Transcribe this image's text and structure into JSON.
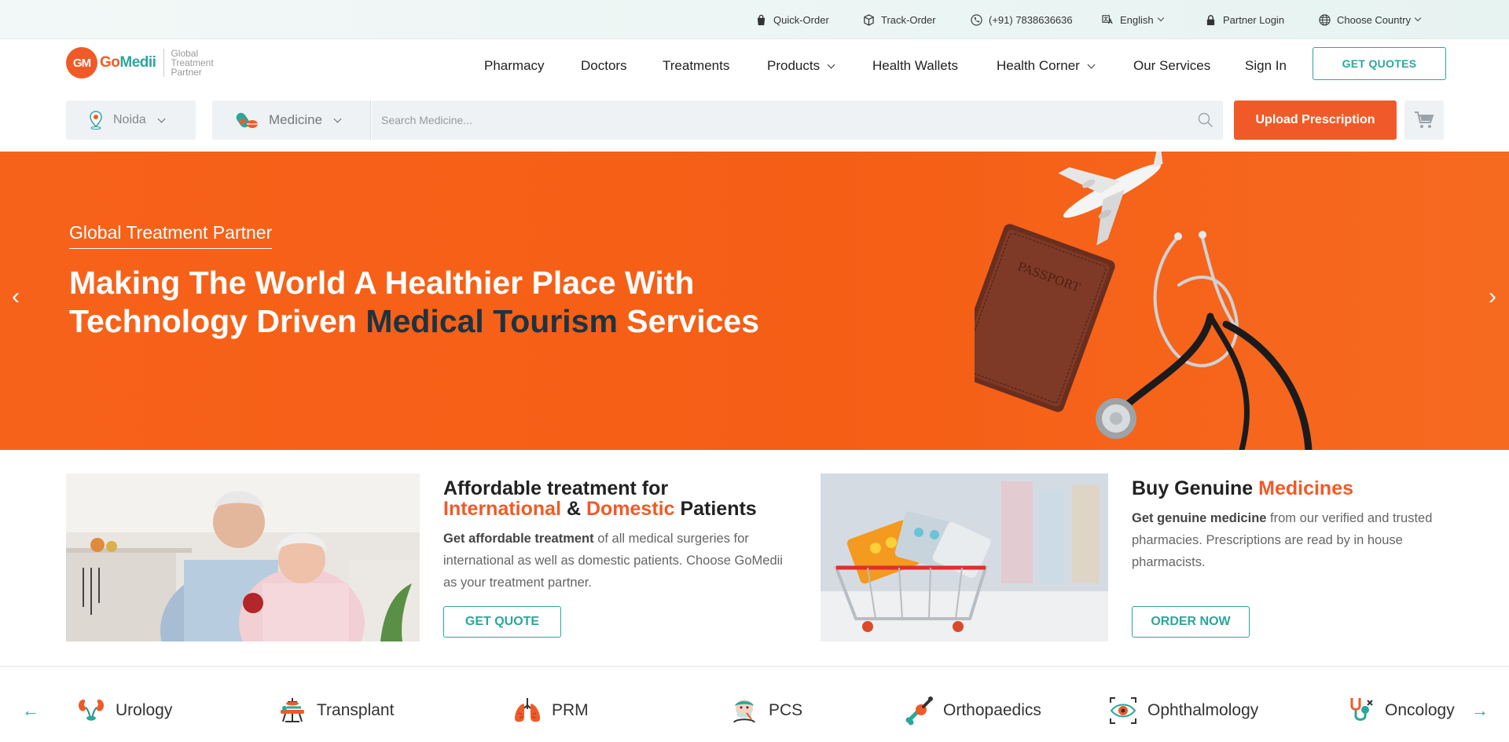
{
  "topbar": {
    "quick_order": "Quick-Order",
    "track_order": "Track-Order",
    "phone": "(+91) 7838636636",
    "language": "English",
    "partner_login": "Partner Login",
    "country": "Choose Country"
  },
  "brand": {
    "mark": "GM",
    "name_a": "Go",
    "name_b": "Medii",
    "tagline": "Global Treatment Partner"
  },
  "nav": {
    "items": [
      "Pharmacy",
      "Doctors",
      "Treatments",
      "Products",
      "Health Wallets",
      "Health Corner",
      "Our Services",
      "Sign In"
    ],
    "get_quotes": "GET QUOTES"
  },
  "search": {
    "location": "Noida",
    "category": "Medicine",
    "placeholder": "Search Medicine...",
    "upload_label": "Upload Prescription"
  },
  "hero": {
    "eyebrow": "Global Treatment Partner",
    "title_part1": "Making The World A Healthier Place With Technology Driven ",
    "title_accent": "Medical Tourism",
    "title_part2": " Services",
    "art_label": "PASSPORT",
    "prev": "‹",
    "next": "›"
  },
  "cards": {
    "treatment": {
      "title_l1": "Affordable treatment for",
      "title_o1": "International",
      "title_amp": " & ",
      "title_o2": "Domestic",
      "title_end": " Patients",
      "body_bold": "Get affordable treatment",
      "body_rest": " of all medical surgeries for international as well as domestic patients. Choose GoMedii as your treatment partner.",
      "button": "GET QUOTE"
    },
    "medicine": {
      "title_a": "Buy Genuine ",
      "title_o": "Medicines",
      "body_bold": "Get genuine medicine",
      "body_rest": " from our verified and trusted pharmacies. Prescriptions are read by in house pharmacists.",
      "button": "ORDER NOW"
    }
  },
  "specialties": {
    "items": [
      "Urology",
      "Transplant",
      "PRM",
      "PCS",
      "Orthopaedics",
      "Ophthalmology",
      "Oncology"
    ],
    "prev": "←",
    "next": "→"
  },
  "colors": {
    "brand_orange": "#f05a28",
    "brand_teal": "#2aa79b",
    "hero_bg": "#f55e15",
    "accent_dark": "#1d3340"
  }
}
